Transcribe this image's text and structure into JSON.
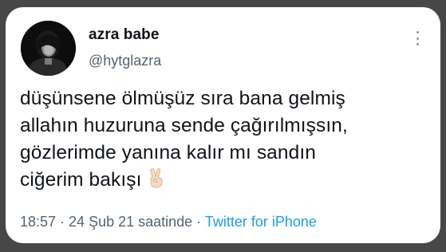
{
  "author": {
    "display_name": "azra babe",
    "username": "@hytglazra",
    "avatar": "profile-photo"
  },
  "tweet": {
    "lines": [
      "düşünsene ölmüşüz sıra bana gelmiş",
      "allahın huzuruna sende çağırılmışsın,",
      "gözlerimde yanına kalır mı sandın",
      "ciğerim bakışı"
    ],
    "emoji": "victory-hand-emoji"
  },
  "meta": {
    "timestamp": "18:57 · 24 Şub 21 saatinde",
    "separator": " · ",
    "source": "Twitter for iPhone"
  },
  "icons": {
    "more": "more-options-icon"
  },
  "colors": {
    "background": "#474747",
    "card": "#ffffff",
    "text": "#0f1419",
    "secondary": "#536471",
    "link": "#1d9bf0"
  }
}
